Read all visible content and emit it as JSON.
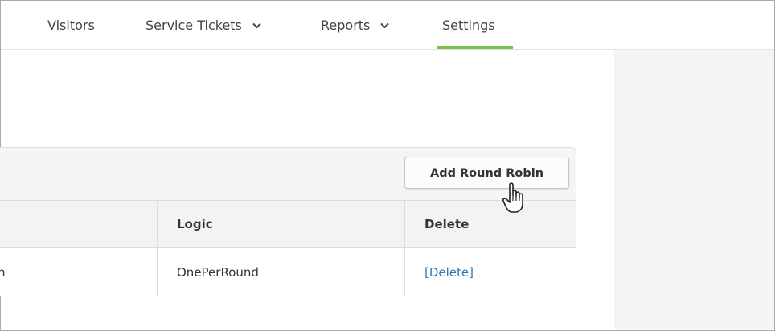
{
  "nav": {
    "items": [
      {
        "label": "Visitors",
        "has_dropdown": false
      },
      {
        "label": "Service Tickets",
        "has_dropdown": true
      },
      {
        "label": "Reports",
        "has_dropdown": true
      },
      {
        "label": "Settings",
        "has_dropdown": false,
        "active": true
      }
    ],
    "active_color": "#7cc24a"
  },
  "panel": {
    "add_button_label": "Add Round Robin"
  },
  "table": {
    "columns": [
      "",
      "Logic",
      "Delete"
    ],
    "rows": [
      {
        "name_fragment": "n",
        "logic": "OnePerRound",
        "delete_label": "[Delete]"
      }
    ]
  },
  "colors": {
    "link": "#2a7ab8",
    "panel_header_bg": "#f5f5f5",
    "side_bg": "#f4f4f4"
  },
  "cursor": "hand-pointer-icon"
}
